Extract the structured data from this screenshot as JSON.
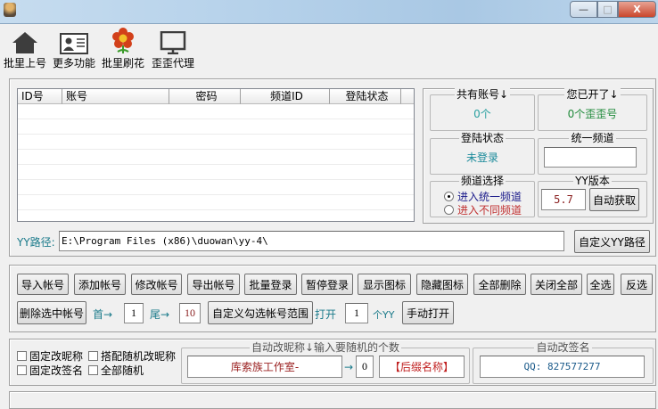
{
  "window": {
    "minimize": "—",
    "maximize": "□",
    "close": "X"
  },
  "toolbar": [
    {
      "label": "批里上号",
      "icon": "home-icon"
    },
    {
      "label": "更多功能",
      "icon": "contact-card-icon"
    },
    {
      "label": "批里刷花",
      "icon": "flower-icon"
    },
    {
      "label": "歪歪代理",
      "icon": "monitor-icon"
    }
  ],
  "table": {
    "columns": [
      "ID号",
      "账号",
      "密码",
      "频道ID",
      "登陆状态"
    ],
    "rows": []
  },
  "stats": {
    "total_accounts": {
      "title": "共有账号↓",
      "value": "0个"
    },
    "opened": {
      "title": "您已开了↓",
      "value": "0个歪歪号"
    },
    "login_status": {
      "title": "登陆状态",
      "value": "未登录"
    },
    "unified_channel": {
      "title": "统一频道",
      "value": ""
    },
    "channel_select": {
      "title": "频道选择",
      "options": [
        "进入统一频道",
        "进入不同频道"
      ],
      "selected": 0
    },
    "yy_version": {
      "title": "YY版本",
      "value": "5.7",
      "button": "自动获取"
    }
  },
  "path": {
    "label": "YY路径:",
    "value": "E:\\Program Files (x86)\\duowan\\yy-4\\",
    "button": "自定义YY路径"
  },
  "actions": [
    "导入帐号",
    "添加帐号",
    "修改帐号",
    "导出帐号",
    "批量登录",
    "暂停登录",
    "显示图标",
    "隐藏图标",
    "全部删除",
    "关闭全部",
    "全选",
    "反选"
  ],
  "range": {
    "delete_selected": "删除选中帐号",
    "first_label": "首→",
    "first_value": "1",
    "last_label": "尾→",
    "last_value": "10",
    "custom_range": "自定义勾选帐号范围",
    "open_label": "打开",
    "open_value": "1",
    "yy_unit": "个YY",
    "manual_open": "手动打开"
  },
  "nickname": {
    "checkboxes": [
      "固定改昵称",
      "搭配随机改昵称",
      "固定改签名",
      "全部随机"
    ],
    "auto_nick_title": "自动改昵称↓输入要随机的个数",
    "nick_value": "库索族工作室-",
    "arrow": "→",
    "random_count": "0",
    "suffix": "【后缀名称】",
    "auto_sig_title": "自动改签名",
    "sig_value": "QQ: 827577277"
  }
}
